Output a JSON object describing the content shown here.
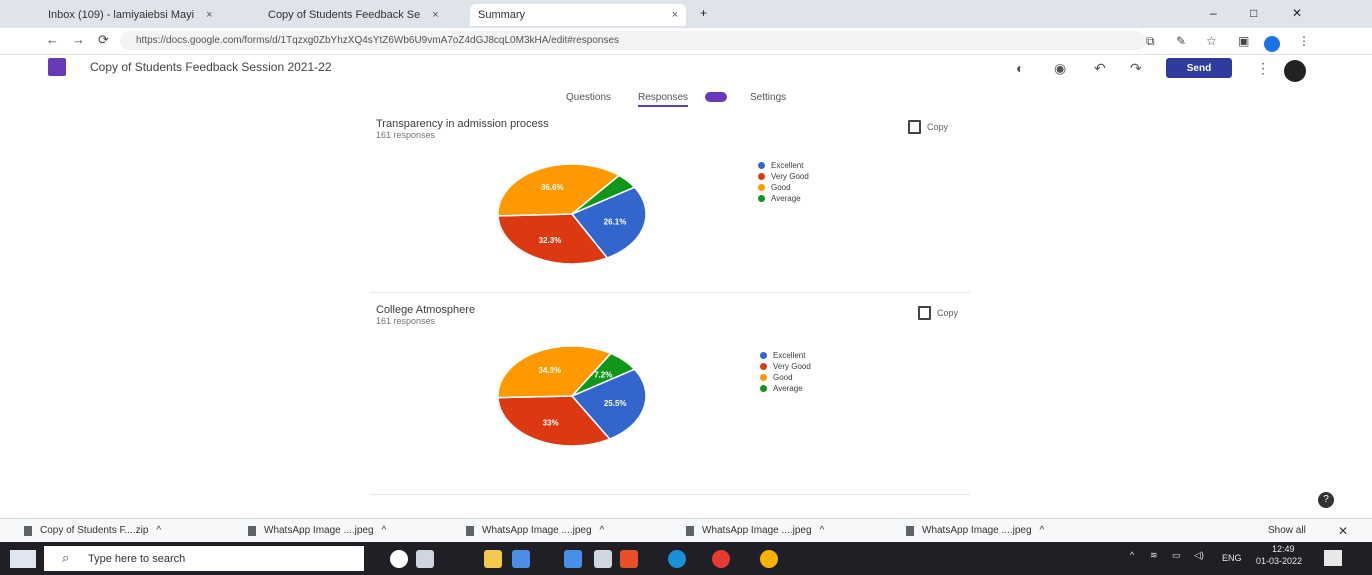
{
  "browser": {
    "tabs": [
      {
        "label": "Inbox (109) - lamiyaiebsi Mayi",
        "close": "×"
      },
      {
        "label": "Copy of Students Feedback Se",
        "close": "×"
      },
      {
        "label": "Summary",
        "close": "×"
      }
    ],
    "new_tab": "+",
    "window_controls": {
      "minimize": "–",
      "maximize": "□",
      "close": "✕"
    },
    "nav": {
      "back": "←",
      "forward": "→",
      "reload": "⟳"
    },
    "url": "https://docs.google.com/forms/d/1Tqzxg0ZbYhzXQ4sYtZ6Wb6U9vmA7oZ4dGJ8cqL0M3kHA/edit#responses"
  },
  "form": {
    "title": "Copy of Students Feedback Session 2021-22",
    "send_label": "Send",
    "tabs": [
      {
        "label": "Questions"
      },
      {
        "label": "Responses"
      },
      {
        "label": "Settings"
      }
    ]
  },
  "questions": [
    {
      "title": "Transparency in admission process",
      "responses": "161 responses",
      "copy_label": "Copy"
    },
    {
      "title": "College Atmosphere",
      "responses": "161 responses",
      "copy_label": "Copy"
    }
  ],
  "chart_data": [
    {
      "type": "pie",
      "title": "Transparency in admission process",
      "labels": [
        "Excellent",
        "Very Good",
        "Good",
        "Average"
      ],
      "values": [
        26.1,
        32.3,
        36.6,
        5.0
      ],
      "value_labels": [
        "26.1%",
        "32.3%",
        "36.6%",
        ""
      ],
      "colors": [
        "#3366cc",
        "#dc3912",
        "#ff9900",
        "#109618"
      ]
    },
    {
      "type": "pie",
      "title": "College Atmosphere",
      "labels": [
        "Excellent",
        "Very Good",
        "Good",
        "Average"
      ],
      "values": [
        25.5,
        33.0,
        34.3,
        7.2
      ],
      "value_labels": [
        "25.5%",
        "33%",
        "34.3%",
        "7.2%"
      ],
      "colors": [
        "#3366cc",
        "#dc3912",
        "#ff9900",
        "#109618"
      ]
    }
  ],
  "downloads": {
    "items": [
      {
        "label": "Copy of Students F....zip"
      },
      {
        "label": "WhatsApp Image ....jpeg"
      },
      {
        "label": "WhatsApp Image ....jpeg"
      },
      {
        "label": "WhatsApp Image ....jpeg"
      },
      {
        "label": "WhatsApp Image ....jpeg"
      }
    ],
    "show_all": "Show all",
    "close": "✕"
  },
  "taskbar": {
    "search_placeholder": "Type here to search",
    "lang": "ENG",
    "time": "12:49",
    "date": "01-03-2022"
  }
}
